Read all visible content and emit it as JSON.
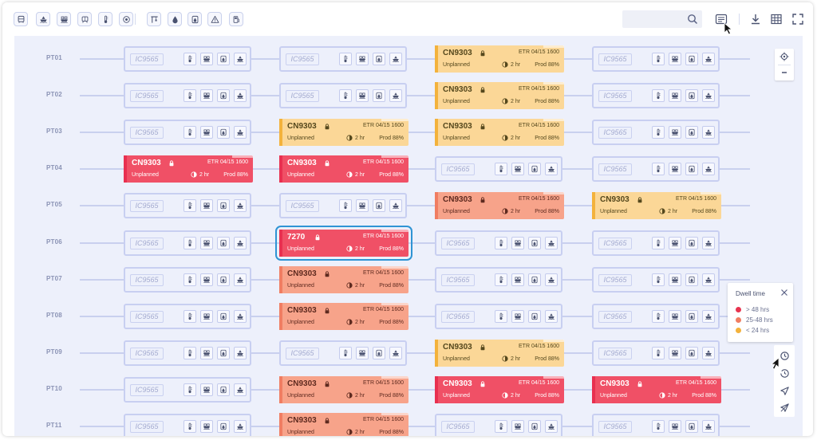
{
  "toolbar": {
    "left_icons": [
      "train-icon",
      "cruise-icon",
      "container-ship-icon",
      "tram-icon",
      "thermometer-icon",
      "target-icon",
      "crane-icon",
      "drop-icon",
      "liquid-cargo-icon",
      "warning-icon",
      "fuel-icon"
    ],
    "search": {
      "value": "",
      "placeholder": ""
    },
    "right_icons": [
      "list-view-icon",
      "download-icon",
      "grid-icon",
      "fullscreen-icon"
    ]
  },
  "slot": {
    "empty_id": "IC9565",
    "card_etr": "ETR 04/15 1600",
    "card_status": "Unplanned",
    "card_hours": "2 hr",
    "card_prod": "Prod 88%"
  },
  "rows": [
    {
      "label": "PT01",
      "cells": [
        "empty",
        "empty",
        "CN9303:yellow",
        "empty"
      ]
    },
    {
      "label": "PT02",
      "cells": [
        "empty",
        "empty",
        "CN9303:yellow",
        "empty"
      ]
    },
    {
      "label": "PT03",
      "cells": [
        "empty",
        "CN9303:yellow",
        "CN9303:yellow",
        "empty"
      ]
    },
    {
      "label": "PT04",
      "cells": [
        "CN9303:red",
        "CN9303:red",
        "empty",
        "empty"
      ]
    },
    {
      "label": "PT05",
      "cells": [
        "empty",
        "empty",
        "CN9303:salmon",
        "CN9303:yellow"
      ]
    },
    {
      "label": "PT06",
      "cells": [
        "empty",
        "7270:red:selected",
        "empty",
        "empty"
      ]
    },
    {
      "label": "PT07",
      "cells": [
        "empty",
        "CN9303:salmon",
        "empty",
        "empty"
      ]
    },
    {
      "label": "PT08",
      "cells": [
        "empty",
        "CN9303:salmon",
        "empty",
        "empty"
      ]
    },
    {
      "label": "PT09",
      "cells": [
        "empty",
        "empty",
        "CN9303:yellow",
        "empty"
      ]
    },
    {
      "label": "PT10",
      "cells": [
        "empty",
        "CN9303:salmon",
        "CN9303:red",
        "CN9303:red"
      ]
    },
    {
      "label": "PT11",
      "cells": [
        "empty",
        "CN9303:salmon",
        "empty",
        "empty"
      ]
    }
  ],
  "legend": {
    "title": "Dwell time",
    "items": [
      {
        "label": "> 48 hrs",
        "color": "#e8344f"
      },
      {
        "label": "25-48 hrs",
        "color": "#f07d62"
      },
      {
        "label": "< 24 hrs",
        "color": "#f3b23c"
      }
    ]
  },
  "colors": {
    "accent": "#2f94d4",
    "red": "#f05066",
    "salmon": "#f7a38a",
    "yellow": "#fbd797"
  }
}
